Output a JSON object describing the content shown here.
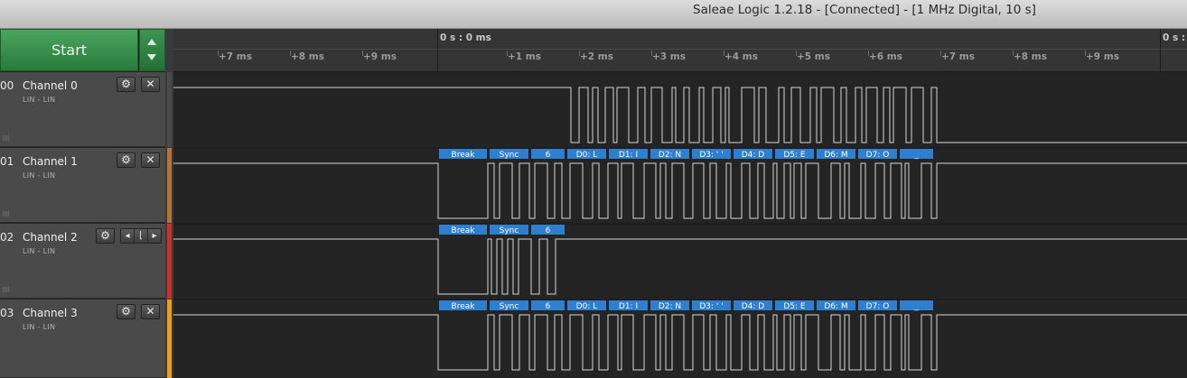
{
  "window": {
    "title": "Saleae Logic 1.2.18 - [Connected] - [1 MHz Digital, 10 s]"
  },
  "toolbar": {
    "start_label": "Start"
  },
  "ruler": {
    "zero_labels": [
      "0 s : 0 ms",
      "0 s :"
    ],
    "ticks": [
      "+7 ms",
      "+8 ms",
      "+9 ms",
      "+1 ms",
      "+2 ms",
      "+3 ms",
      "+4 ms",
      "+5 ms",
      "+6 ms",
      "+7 ms",
      "+8 ms",
      "+9 ms"
    ]
  },
  "channels": [
    {
      "num": "00",
      "name": "Channel 0",
      "analyzer": "LIN - LIN",
      "color": "#4a4a4a",
      "has_trigger": false
    },
    {
      "num": "01",
      "name": "Channel 1",
      "analyzer": "LIN - LIN",
      "color": "#b87333",
      "has_trigger": false
    },
    {
      "num": "02",
      "name": "Channel 2",
      "analyzer": "LIN - LIN",
      "color": "#d0302a",
      "has_trigger": true
    },
    {
      "num": "03",
      "name": "Channel 3",
      "analyzer": "LIN - LIN",
      "color": "#e8a020",
      "has_trigger": false
    }
  ],
  "icons": {
    "settings": "gear-icon",
    "close": "close-icon",
    "trigger_prev": "triangle-left-icon",
    "trigger_edge": "falling-edge-icon",
    "trigger_next": "triangle-right-icon"
  },
  "decoder_frames": {
    "full": [
      "Break",
      "Sync",
      "6",
      "D0: L",
      "D1: I",
      "D2: N",
      "D3: ' '",
      "D4: D",
      "D5: E",
      "D6: M",
      "D7: O",
      "_"
    ],
    "partial": [
      "Break",
      "Sync",
      "6"
    ]
  },
  "colors": {
    "badge": "#2f7fd0",
    "wave": "#d6d6d6",
    "start": "#3a8f4f"
  }
}
